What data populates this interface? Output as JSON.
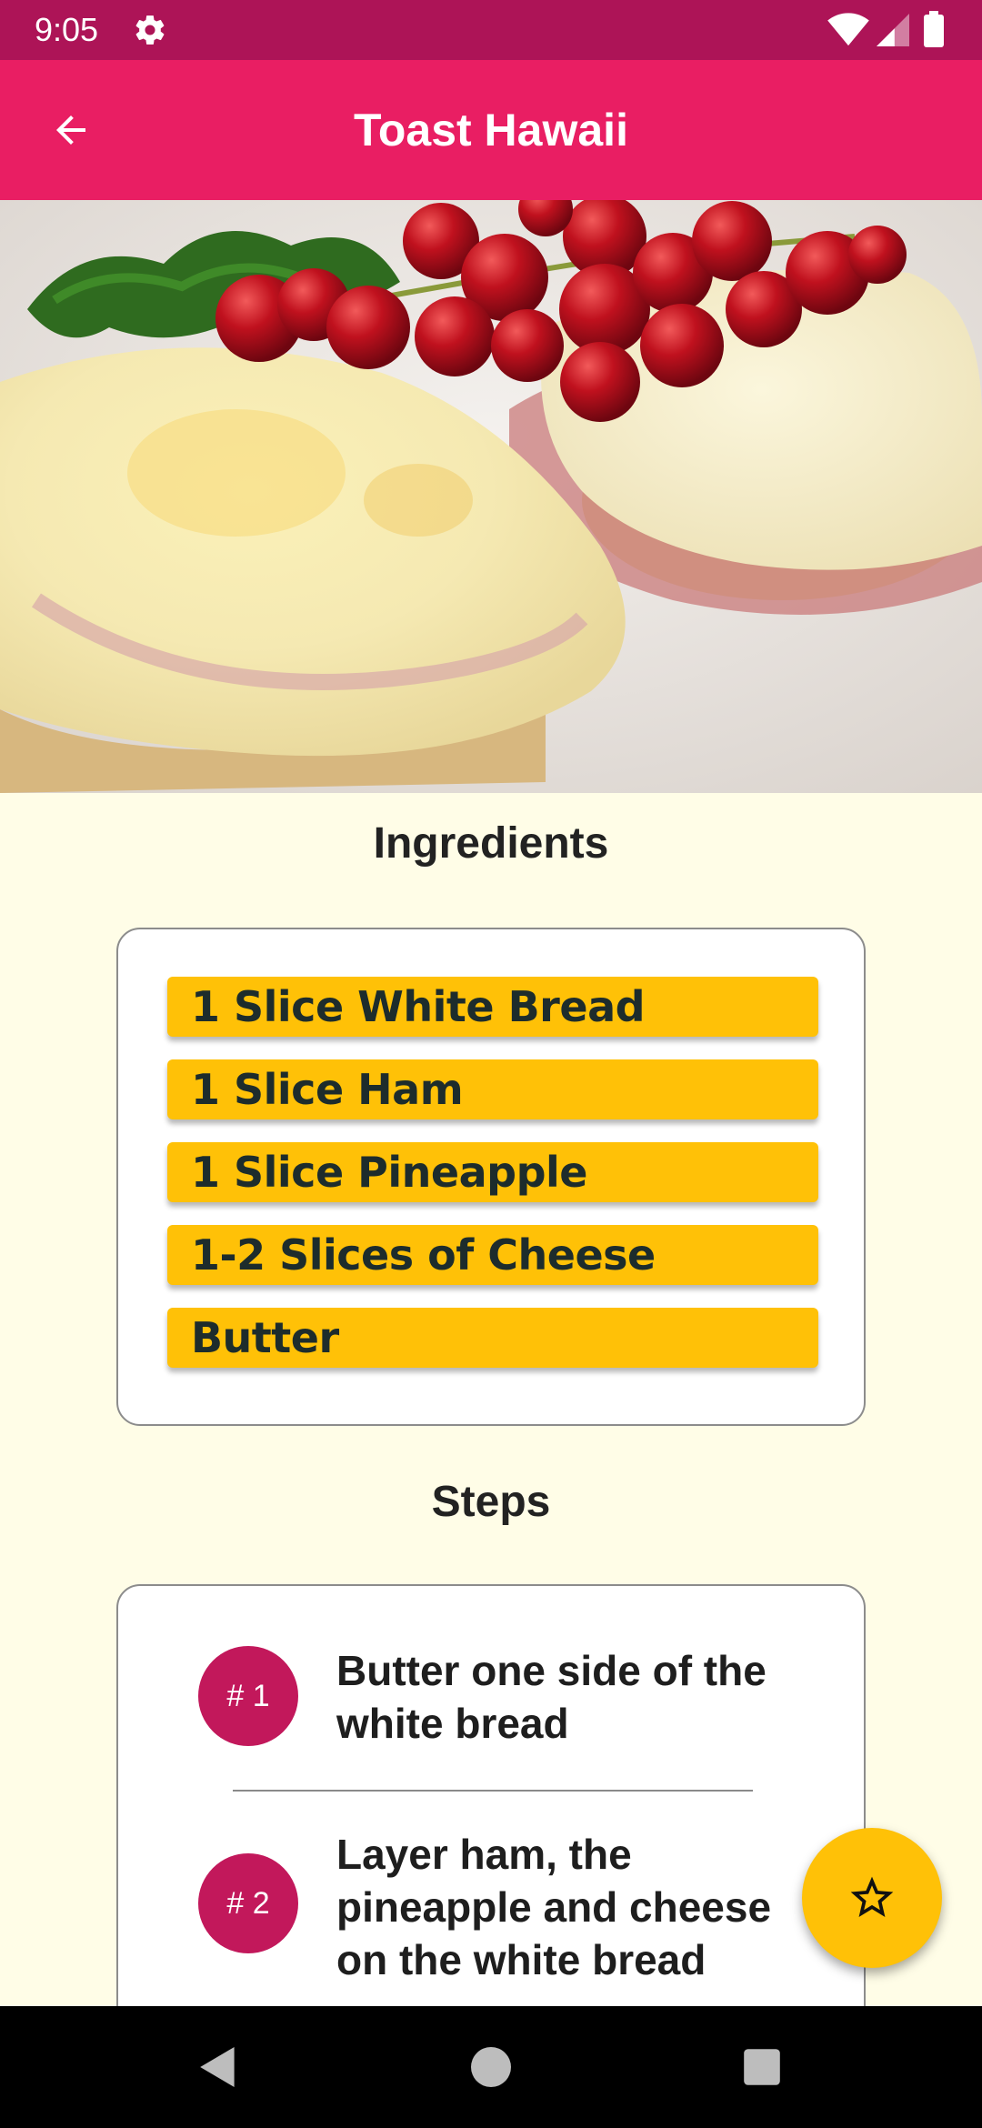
{
  "status_bar": {
    "time": "9:05",
    "icons": [
      "gear-icon",
      "wifi-icon",
      "signal-icon",
      "battery-icon"
    ]
  },
  "app_bar": {
    "title": "Toast Hawaii",
    "back_icon": "arrow-back-icon"
  },
  "ingredients": {
    "title": "Ingredients",
    "items": [
      "1 Slice White Bread",
      "1 Slice Ham",
      "1 Slice Pineapple",
      "1-2 Slices of Cheese",
      "Butter"
    ]
  },
  "steps": {
    "title": "Steps",
    "items": [
      {
        "badge": "# 1",
        "text": "Butter one side of the white bread"
      },
      {
        "badge": "# 2",
        "text": "Layer ham, the pineapple and cheese on the white bread"
      }
    ]
  },
  "fab": {
    "icon": "star-outline-icon"
  },
  "colors": {
    "status_bar": "#ad1457",
    "app_bar": "#e91e63",
    "background": "#fffde7",
    "ingredient_chip": "#ffc107",
    "step_badge": "#c2185b",
    "fab": "#ffc107"
  },
  "nav_bar": {
    "icons": [
      "back-triangle-icon",
      "home-circle-icon",
      "recents-square-icon"
    ]
  }
}
